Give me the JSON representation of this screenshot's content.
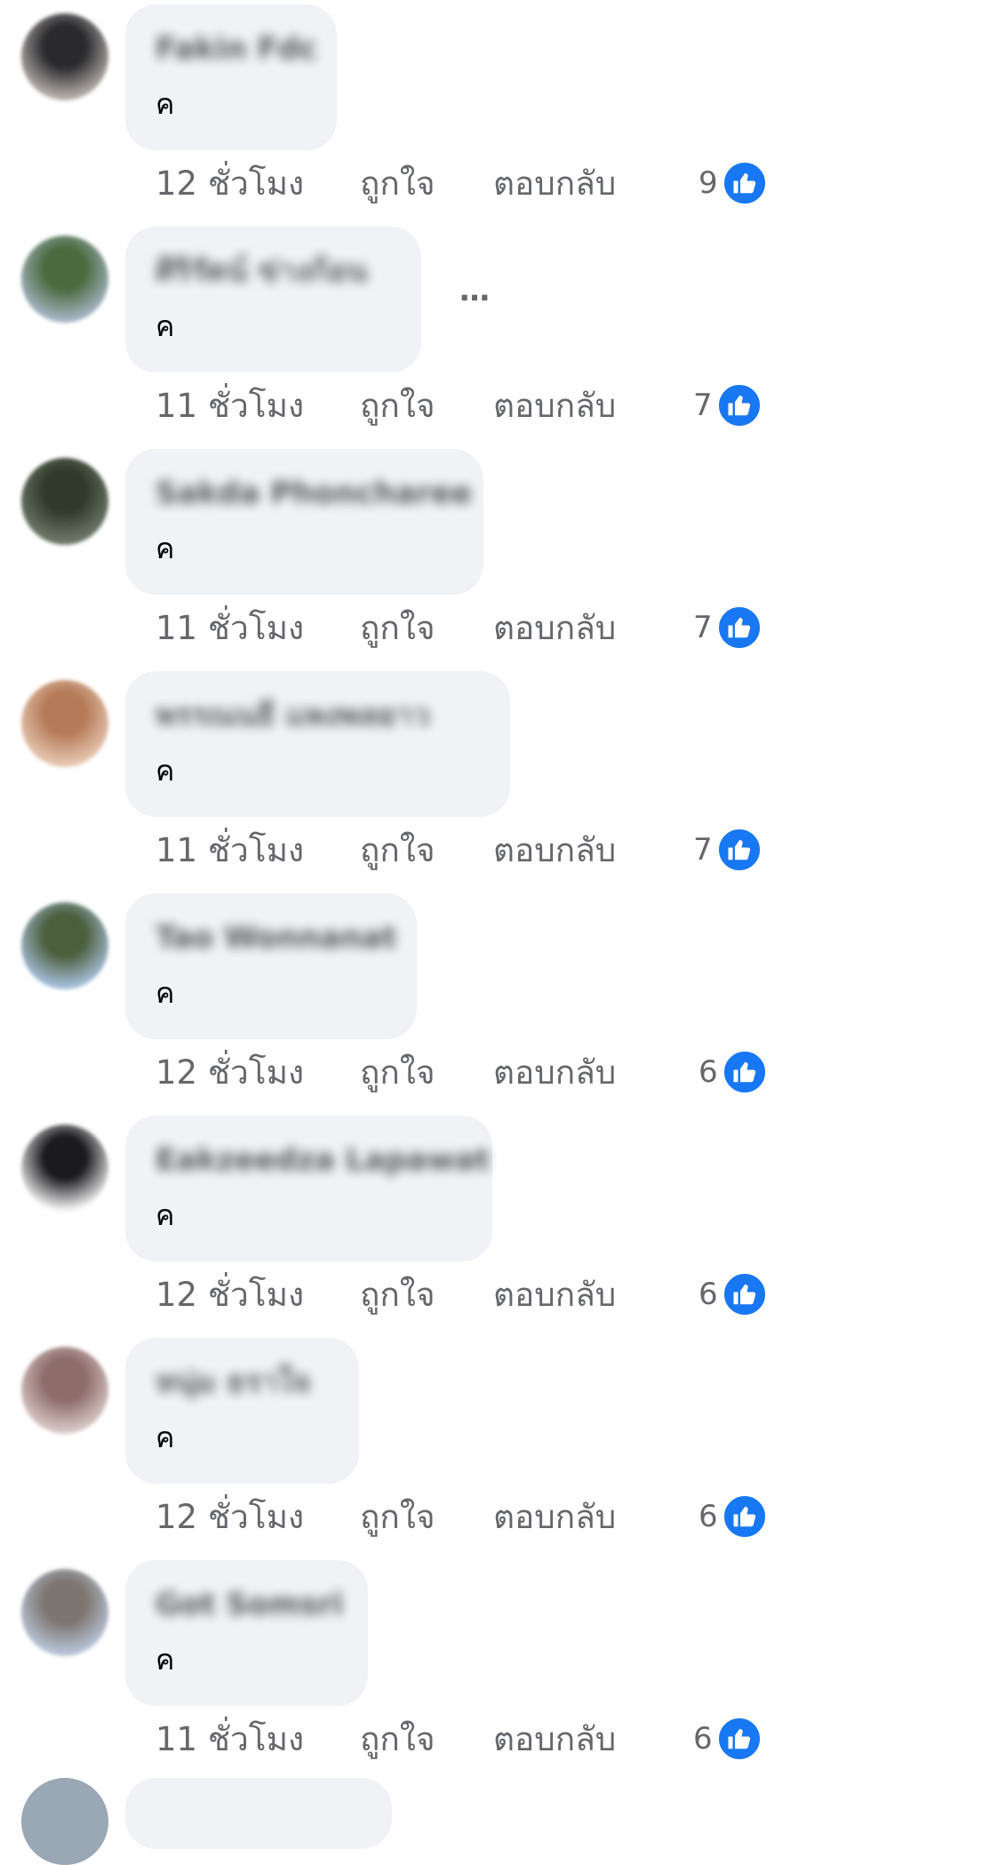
{
  "labels": {
    "like": "ถูกใจ",
    "reply": "ตอบกลับ",
    "more": "…"
  },
  "comments": [
    {
      "name": "Fakin Fdc",
      "text": "ค",
      "time": "12 ชั่วโมง",
      "likes": "9",
      "avatar_colors": [
        "#b9b2ad",
        "#2a2a2e"
      ]
    },
    {
      "name": "ศิริรัตน์ ข่างก้อน",
      "text": "ค",
      "time": "11 ชั่วโมง",
      "likes": "7",
      "avatar_colors": [
        "#a7b6c7",
        "#4b6b3f"
      ],
      "has_more": true
    },
    {
      "name": "Sakda Phoncharee",
      "text": "ค",
      "time": "11 ชั่วโมง",
      "likes": "7",
      "avatar_colors": [
        "#6f7a6a",
        "#2f3a2a"
      ]
    },
    {
      "name": "พรรณนธี แพงพลยาว",
      "text": "ค",
      "time": "11 ชั่วโมง",
      "likes": "7",
      "avatar_colors": [
        "#e7c9b3",
        "#b57b59"
      ]
    },
    {
      "name": "Tao Wonnanat",
      "text": "ค",
      "time": "12 ชั่วโมง",
      "likes": "6",
      "avatar_colors": [
        "#a7c0dc",
        "#4c5f3d"
      ]
    },
    {
      "name": "Eakzeedza Lapawat",
      "text": "ค",
      "time": "12 ชั่วโมง",
      "likes": "6",
      "avatar_colors": [
        "#f1f1f1",
        "#1b1b1f"
      ]
    },
    {
      "name": "หนุ่ม ธราใจ",
      "text": "ค",
      "time": "12 ชั่วโมง",
      "likes": "6",
      "avatar_colors": [
        "#d9c9c6",
        "#8d6c6a"
      ]
    },
    {
      "name": "Got Somsri",
      "text": "ค",
      "time": "11 ชั่วโมง",
      "likes": "6",
      "avatar_colors": [
        "#b9c6da",
        "#7d756f"
      ]
    }
  ]
}
